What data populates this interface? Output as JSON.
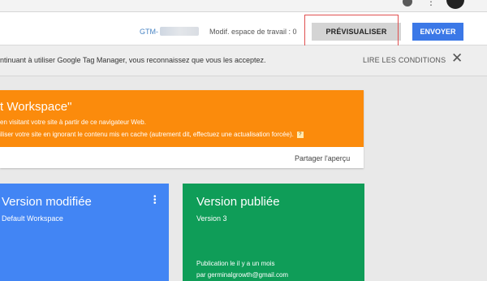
{
  "toolbar": {
    "gtm_id_prefix": "GTM-",
    "workspace_changes": "Modif. espace de travail : 0",
    "preview_label": "PRÉVISUALISER",
    "send_label": "ENVOYER"
  },
  "notice": {
    "text": "ntinuant à utiliser Google Tag Manager, vous reconnaissez que vous les acceptez.",
    "read_conditions": "LIRE LES CONDITIONS",
    "close_icon": "close-icon"
  },
  "preview_card": {
    "title": "t Workspace\"",
    "line1": "en visitant votre site à partir de ce navigateur Web.",
    "line2": "iliser votre site en ignorant le contenu mis en cache (autrement dit, effectuez une actualisation forcée).",
    "help": "?",
    "share": "Partager l'aperçu",
    "color": "#fb8b0c"
  },
  "cards": {
    "modified": {
      "title": "Version modifiée",
      "subtitle": "Default Workspace",
      "color": "#4285f4"
    },
    "published": {
      "title": "Version publiée",
      "subtitle": "Version 3",
      "published_line": "Publication le il y a un mois",
      "published_by": "par germinalgrowth@gmail.com",
      "color": "#0f9d58"
    }
  },
  "colors": {
    "highlight": "#e05050",
    "send_button": "#3b78e7"
  }
}
